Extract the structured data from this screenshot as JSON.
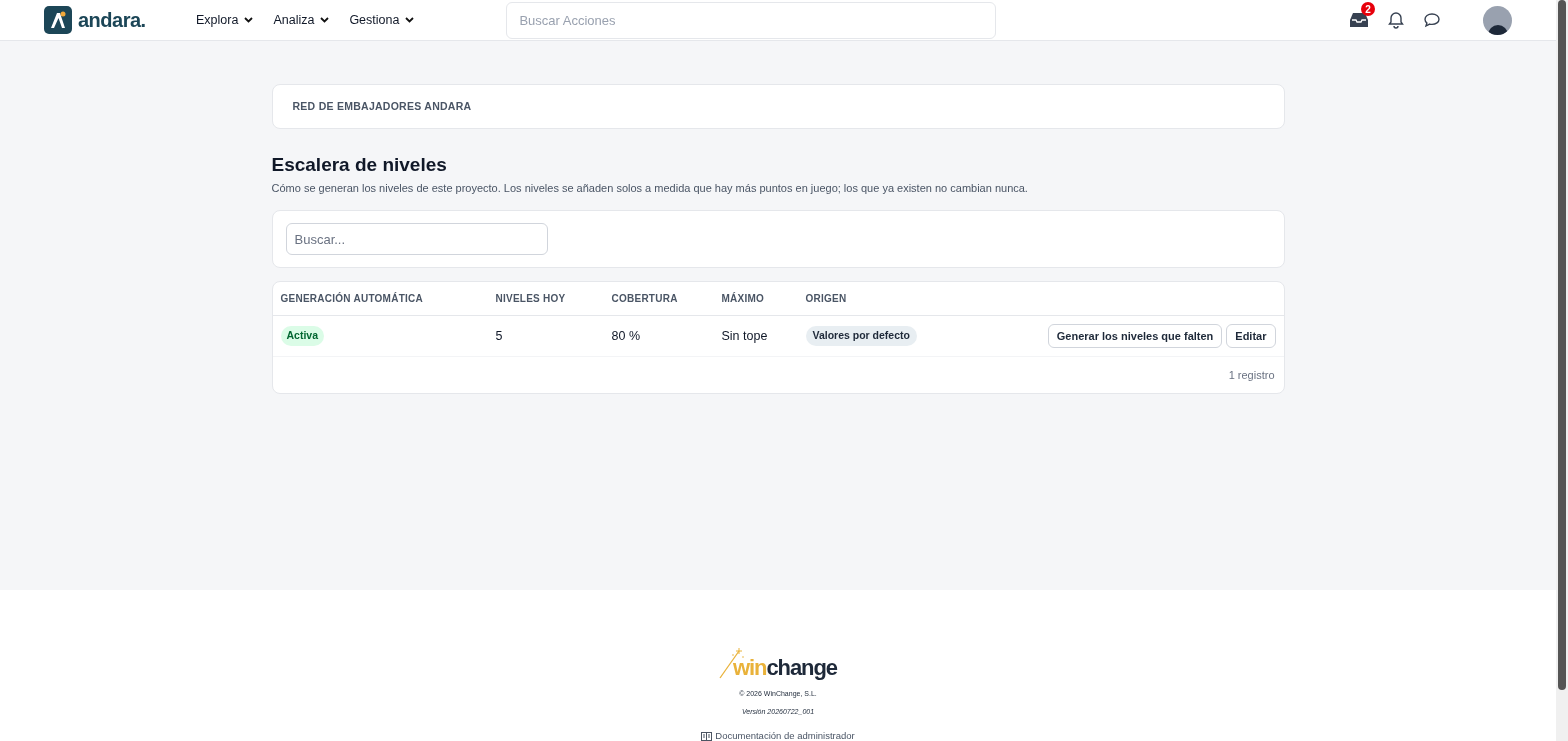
{
  "header": {
    "logo_text": "andara.",
    "menus": [
      {
        "label": "Explora"
      },
      {
        "label": "Analiza"
      },
      {
        "label": "Gestiona"
      }
    ],
    "search": {
      "placeholder": "Buscar Acciones"
    },
    "inbox_badge": "2"
  },
  "breadcrumb": "RED DE EMBAJADORES ANDARA",
  "page": {
    "title": "Escalera de niveles",
    "description": "Cómo se generan los niveles de este proyecto. Los niveles se añaden solos a medida que hay más puntos en juego; los que ya existen no cambian nunca."
  },
  "filter": {
    "placeholder": "Buscar..."
  },
  "table": {
    "columns": [
      "GENERACIÓN AUTOMÁTICA",
      "NIVELES HOY",
      "COBERTURA",
      "MÁXIMO",
      "ORIGEN"
    ],
    "rows": [
      {
        "status": {
          "label": "Activa",
          "active": true
        },
        "levels": "5",
        "coverage": "80 %",
        "max": "Sin tope",
        "origin": "Valores por defecto",
        "actions": [
          "Generar los niveles que falten",
          "Editar"
        ]
      }
    ],
    "count": "1 registro"
  },
  "footer": {
    "brand_prefix": "win",
    "brand_suffix": "change",
    "copyright": "© 2026 WinChange, S.L.",
    "version": "Versión 20260722_001",
    "doc_link": "Documentación de administrador"
  }
}
